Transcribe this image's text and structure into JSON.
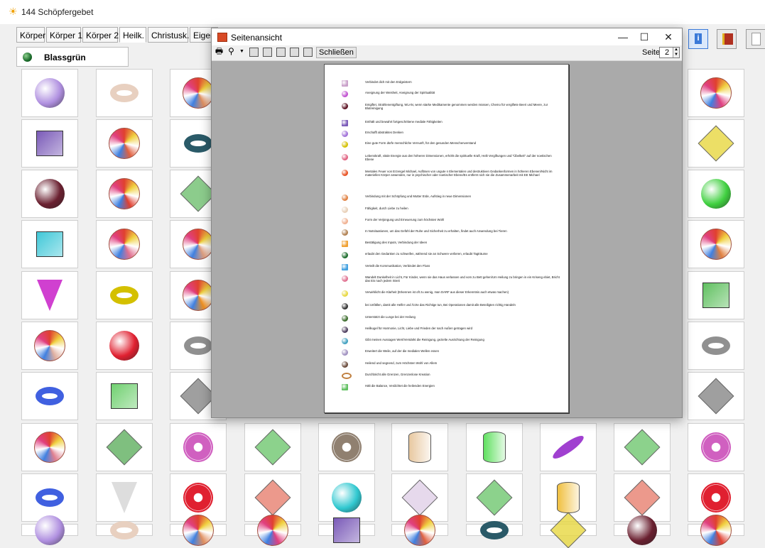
{
  "window": {
    "title": "144 Schöpfergebet"
  },
  "tabs": [
    {
      "label": "Körper",
      "active": false
    },
    {
      "label": "Körper 1",
      "active": false
    },
    {
      "label": "Körper 2",
      "active": false
    },
    {
      "label": "Heilk.",
      "active": true
    },
    {
      "label": "Christusk.",
      "active": false
    },
    {
      "label": "Eigen",
      "active": false
    }
  ],
  "selected_item": {
    "label": "Blassgrün",
    "color": "#1a6b2a"
  },
  "dialog": {
    "title": "Seitenansicht",
    "close_label": "Schließen",
    "page_label": "Seite",
    "page_value": "2",
    "window_buttons": [
      "—",
      "☐",
      "✕"
    ]
  },
  "preview_rows": [
    {
      "text": "Verbindet dich mit den Erdgeistern",
      "icon": "pink-striped-pillar",
      "color": "#c9a0c9"
    },
    {
      "text": "Aneignung der Weisheit, Aneignung der Spiritualität",
      "icon": "purple-cone",
      "color": "#c050d0"
    },
    {
      "text": "Entgiftet, Strahlenentgiftung, WLAN, wenn starke Medikamente genommen werden müssen, Chemo für vergiftete Beeri und Meere, zur Blutreinigung",
      "icon": "dark-red-sphere",
      "color": "#5a1020"
    },
    {
      "text": "Enthält und bewahrt fortgeschrittene mediale Fähigkeiten",
      "icon": "purple-cube",
      "color": "#7a5ab8"
    },
    {
      "text": "Erschafft abstraktes Denken",
      "icon": "violet-sphere",
      "color": "#a070d8"
    },
    {
      "text": "Eine gute Form dürfe menschliche Vernunft, für den gesunden Menschenverstand",
      "icon": "yellow-torus",
      "color": "#d4c000"
    },
    {
      "text": "Lebenskraft, vitale Energie aus den höheren Dimensionen, erhöht die spirituelle Kraft, Heilt Vergiftungen und \"Übelkeit\" auf der noetischen Ebene",
      "icon": "pink-beachball",
      "color": "#e06080"
    },
    {
      "text": "Mentales Feuer von Erzengel Michael, Auflösen von ungute n Elementalen und destruktiven Gedankenformen in höheren Ebenen/Nicht im materiellen Körper anwenden, nur in psychischer oder noetischer Ebene/Es entfernt sich nie die Zusammenarbeit mit EE Michael",
      "icon": "red-orange-ball",
      "color": "#e85020"
    },
    {
      "text": "Verbindung mit der Schöpfung und Mutter Erde, Aufstieg in neue Dimensionen",
      "icon": "rainbow-ball",
      "color": "#e08040"
    },
    {
      "text": "Fähigkeit, durch Liebe zu heilen",
      "icon": "beige-ball",
      "color": "#e8d0b8"
    },
    {
      "text": "Form der Verjüngung und Erneuerung zum höchsten Wohl",
      "icon": "peach-ball",
      "color": "#f0b090"
    },
    {
      "text": "In Notsituationen, um das Gefühl der Ruhe und Sicherheit zu erhalten, findet auch Anwendung bei Tieren",
      "icon": "brown-ball",
      "color": "#b08050"
    },
    {
      "text": "Bestätigung des Inputs, Verbindung der Ideen",
      "icon": "orange-cylinder",
      "color": "#f0a030"
    },
    {
      "text": "erlaubt den Gedanken zu schweifen, während sie an Schwere verlieren, erlaubt Tagträume",
      "icon": "green-sphere",
      "color": "#1a6b2a"
    },
    {
      "text": "Verteilt die Kommunikation, Verbindet den Fluss",
      "icon": "blue-cube",
      "color": "#40a0e0"
    },
    {
      "text": "Wandelt Dunkelheit in Licht, Für Kinder, wenn sie das Haus verlassen und vom zu Bett gehen/Um Heilung zu bringen in ein Kriseng ebiet, Bricht das Eis nach jedem Streit",
      "icon": "pink-ball",
      "color": "#e07090"
    },
    {
      "text": "Verwirklicht die Klarheit (Erkennen ist oft zu wenig, man DARF aus dieser Erkenntnis auch etwas machen)",
      "icon": "yellow-octahedron",
      "color": "#e8d840"
    },
    {
      "text": "bei Unfällen, damit alle Helfer und Ärzte das Richtige tun, Bei Operationen damit alle Beteiligten richtig Handeln",
      "icon": "dark-sphere",
      "color": "#303030"
    },
    {
      "text": "Unterstützt die Lunge bei der Heilung",
      "icon": "green-gold-ball",
      "color": "#3a6a2a"
    },
    {
      "text": "Heilkugel für Harmonie, Licht, Liebe und Frieden der nach Außen getragen wird",
      "icon": "purple-ball",
      "color": "#504060"
    },
    {
      "text": "Gibt meinen Aussagen Wert/Verstärkt die Reinigung, gezielte Ausrichtung der Reinigung",
      "icon": "teal-arrow",
      "color": "#40a0c0"
    },
    {
      "text": "Erweitert die Weile, auf der die medialen Wellen essen",
      "icon": "lilac-ball",
      "color": "#a090c0"
    },
    {
      "text": "Heilend und segnend, zum Höchsten Wohl von Allem",
      "icon": "brown-dark-ball",
      "color": "#6a4a3a"
    },
    {
      "text": "Durchbricht alle Grenzen, Grenzenlose Kreation",
      "icon": "infinity",
      "color": "#c08040"
    },
    {
      "text": "Hält die Balance, Verdichtet die heilenden Energien",
      "icon": "green-cube",
      "color": "#60c060"
    }
  ],
  "grid_items": [
    {
      "name": "violet-sphere",
      "color": "#b090e0"
    },
    {
      "name": "beige-torus-ball",
      "color": "#e8d0c0"
    },
    {
      "name": "beachball",
      "color": "#e09060"
    },
    {
      "name": "beachball-pink",
      "color": "#e04080"
    },
    {
      "name": "purple-cube",
      "color": "#7a5ab8"
    },
    {
      "name": "rainbow-ball",
      "color": "#e06040"
    },
    {
      "name": "teal-torus",
      "color": "#2a5a68"
    },
    {
      "name": "yellow-octahedron",
      "color": "#e8d840"
    },
    {
      "name": "dark-red-sphere",
      "color": "#6a2030"
    },
    {
      "name": "red-beachball",
      "color": "#e04030"
    },
    {
      "name": "green-icosahedron",
      "color": "#70c070"
    },
    {
      "name": "green-sphere",
      "color": "#40d040"
    },
    {
      "name": "cyan-cube",
      "color": "#40c8d8"
    },
    {
      "name": "pink-beachball",
      "color": "#e07090"
    },
    {
      "name": "peach-beachball",
      "color": "#e0a080"
    },
    {
      "name": "rainbow-beachball",
      "color": "#e08040"
    },
    {
      "name": "pink-cone",
      "color": "#d040d0"
    },
    {
      "name": "yellow-torus",
      "color": "#d4c000"
    },
    {
      "name": "orange-beachball",
      "color": "#f09020"
    },
    {
      "name": "green-cube",
      "color": "#60c060"
    },
    {
      "name": "beige-beachball",
      "color": "#e0b0a0"
    },
    {
      "name": "red-sphere",
      "color": "#e02030"
    },
    {
      "name": "grey-torus",
      "color": "#909090"
    },
    {
      "name": "grey-torus-2",
      "color": "#909090"
    },
    {
      "name": "rainbow-torus",
      "color": "#4060e0"
    },
    {
      "name": "green-cube-2",
      "color": "#70d070"
    },
    {
      "name": "grey-octahedron",
      "color": "#888888"
    },
    {
      "name": "grey-octahedron-2",
      "color": "#888888"
    },
    {
      "name": "pink-beachball-2",
      "color": "#e08090"
    },
    {
      "name": "green-icosahedron-2",
      "color": "#60b060"
    },
    {
      "name": "pink-medallion",
      "color": "#d060c0"
    },
    {
      "name": "green-octahedron",
      "color": "#70c870"
    },
    {
      "name": "mandala-disc",
      "color": "#908070"
    },
    {
      "name": "beige-cylinder",
      "color": "#e8c8a0"
    },
    {
      "name": "green-cylinder",
      "color": "#60e060"
    },
    {
      "name": "purple-feather",
      "color": "#a040d0"
    },
    {
      "name": "green-octahedron-2",
      "color": "#70c870"
    },
    {
      "name": "pink-medallion-2",
      "color": "#d060c0"
    },
    {
      "name": "rainbow-torus-2",
      "color": "#4060e0"
    },
    {
      "name": "white-cone",
      "color": "#dddddd"
    },
    {
      "name": "red-medallion",
      "color": "#e02030"
    },
    {
      "name": "salmon-dodecahedron",
      "color": "#e88070"
    },
    {
      "name": "cyan-sphere",
      "color": "#30c8d0"
    },
    {
      "name": "white-icosahedron",
      "color": "#e0d0e8"
    },
    {
      "name": "green-octahedron-3",
      "color": "#70c870"
    },
    {
      "name": "yellow-cylinder",
      "color": "#f0c040"
    },
    {
      "name": "salmon-dodecahedron-2",
      "color": "#e88070"
    },
    {
      "name": "red-medallion-2",
      "color": "#e02030"
    }
  ]
}
